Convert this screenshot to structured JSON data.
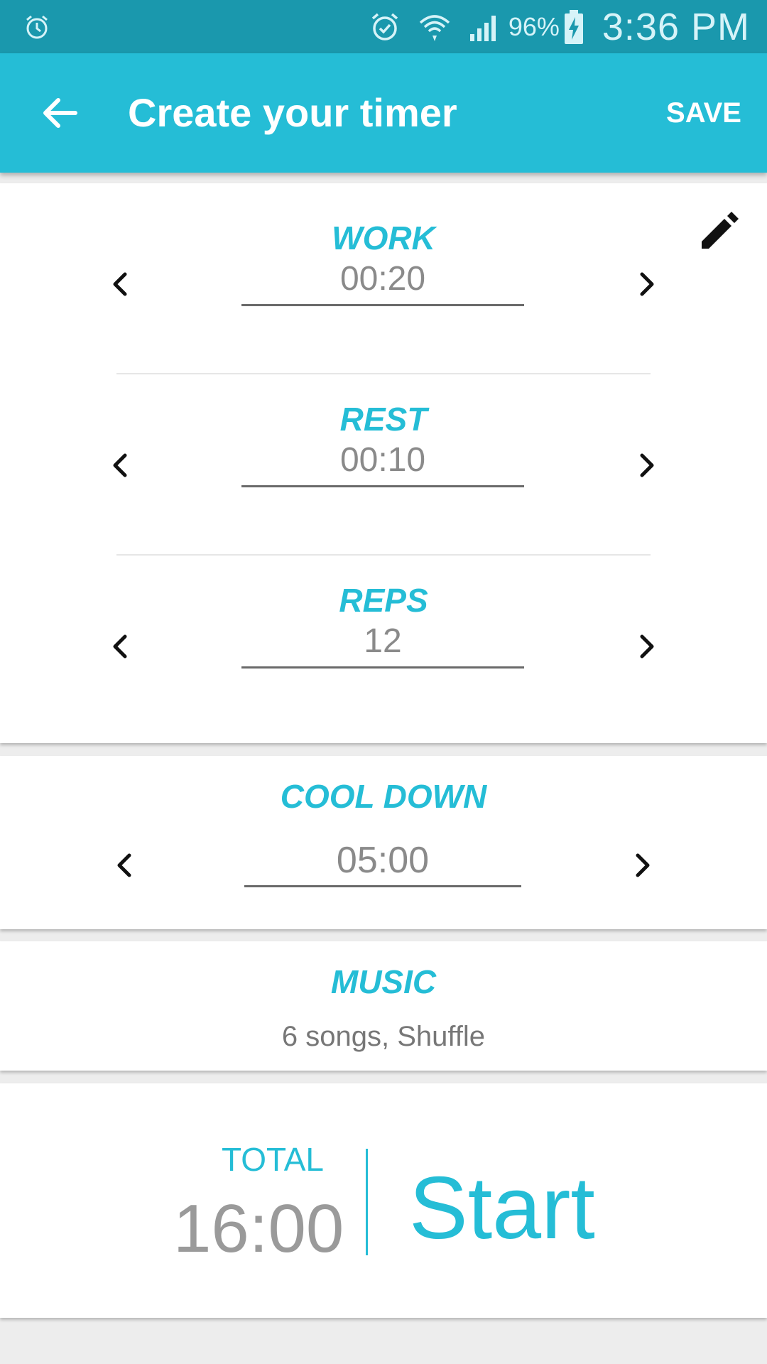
{
  "status_bar": {
    "battery_percent": "96%",
    "time": "3:36 PM",
    "icons": [
      "alarm-icon",
      "alarm-clock-icon",
      "wifi-icon",
      "cell-signal-icon",
      "battery-charging-icon"
    ]
  },
  "app_bar": {
    "back_icon": "arrow-left-icon",
    "title": "Create your timer",
    "save_label": "SAVE"
  },
  "timer": {
    "edit_icon": "pencil-icon",
    "work": {
      "label": "WORK",
      "value": "00:20"
    },
    "rest": {
      "label": "REST",
      "value": "00:10"
    },
    "reps": {
      "label": "REPS",
      "value": "12"
    }
  },
  "cooldown": {
    "label": "COOL DOWN",
    "value": "05:00"
  },
  "music": {
    "label": "MUSIC",
    "summary": "6 songs, Shuffle"
  },
  "total": {
    "label": "TOTAL",
    "value": "16:00",
    "start_label": "Start"
  },
  "colors": {
    "accent": "#25bdd6",
    "status_bar": "#1a98ad",
    "value_text": "#8a8a8a"
  }
}
